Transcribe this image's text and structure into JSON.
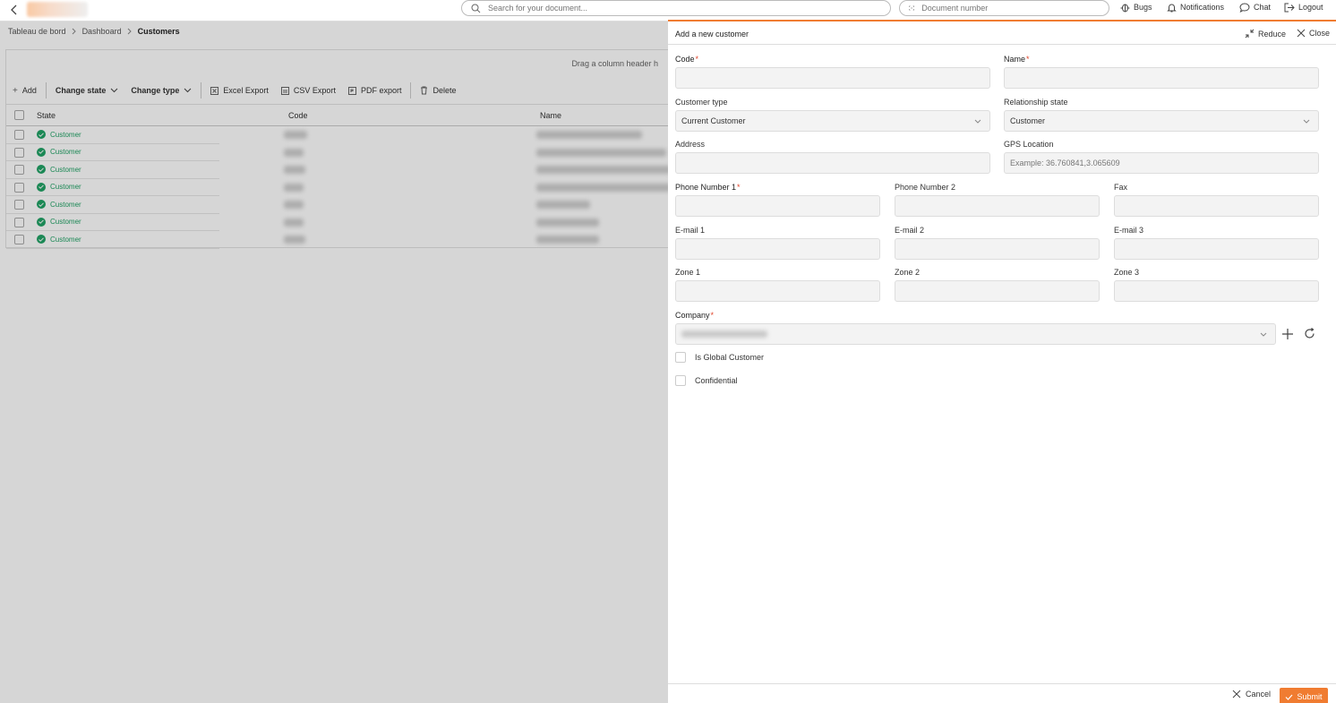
{
  "topbar": {
    "search_placeholder": "Search for your document...",
    "docnum_placeholder": "Document number",
    "bugs": "Bugs",
    "notifications": "Notifications",
    "chat": "Chat",
    "logout": "Logout"
  },
  "breadcrumb": {
    "root": "Tableau de bord",
    "mid": "Dashboard",
    "current": "Customers"
  },
  "grid": {
    "drag_hint": "Drag a column header h",
    "toolbar": {
      "add": "Add",
      "change_state": "Change state",
      "change_type": "Change type",
      "excel": "Excel Export",
      "csv": "CSV Export",
      "pdf": "PDF export",
      "delete": "Delete"
    },
    "columns": [
      "State",
      "Code",
      "Name"
    ],
    "rows": [
      {
        "state": "Customer"
      },
      {
        "state": "Customer"
      },
      {
        "state": "Customer"
      },
      {
        "state": "Customer"
      },
      {
        "state": "Customer"
      },
      {
        "state": "Customer"
      },
      {
        "state": "Customer"
      }
    ]
  },
  "drawer": {
    "title": "Add a new customer",
    "reduce": "Reduce",
    "close": "Close",
    "labels": {
      "code": "Code",
      "name": "Name",
      "customer_type": "Customer type",
      "relationship_state": "Relationship state",
      "address": "Address",
      "gps": "GPS Location",
      "phone1": "Phone Number 1",
      "phone2": "Phone Number 2",
      "fax": "Fax",
      "email1": "E-mail 1",
      "email2": "E-mail 2",
      "email3": "E-mail 3",
      "zone1": "Zone 1",
      "zone2": "Zone 2",
      "zone3": "Zone 3",
      "company": "Company"
    },
    "required_mark": "*",
    "customer_type_value": "Current Customer",
    "relationship_state_value": "Customer",
    "gps_placeholder": "Example: 36.760841,3.065609",
    "is_global": "Is Global Customer",
    "confidential": "Confidential",
    "cancel": "Cancel",
    "submit": "Submit"
  },
  "colors": {
    "accent": "#f07c31",
    "success": "#21a366"
  }
}
